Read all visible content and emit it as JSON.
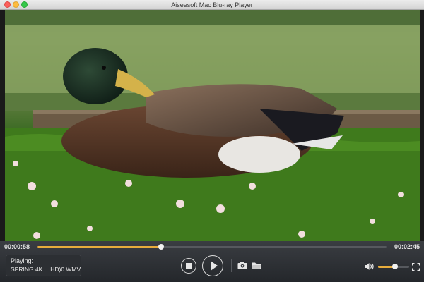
{
  "window": {
    "title": "Aiseesoft Mac Blu-ray Player"
  },
  "playback": {
    "current_time": "00:00:58",
    "total_time": "00:02:45",
    "progress_fraction": 0.355,
    "playing_label": "Playing:",
    "file_name": "SPRING 4K… HD)0.WMV",
    "volume_fraction": 0.55
  },
  "icons": {
    "stop": "stop-icon",
    "play": "play-icon",
    "snapshot": "camera-icon",
    "open": "folder-icon",
    "volume": "speaker-icon",
    "fullscreen": "fullscreen-icon"
  },
  "colors": {
    "accent": "#e7ac3c",
    "control_bar": "#2b2e32"
  }
}
